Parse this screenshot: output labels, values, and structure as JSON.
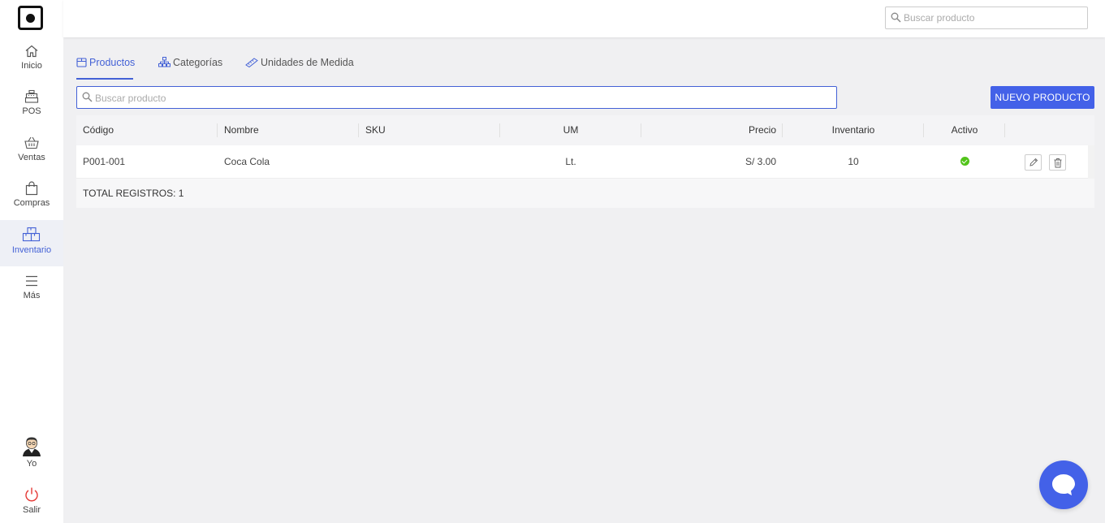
{
  "sidebar": {
    "items": [
      {
        "label": "Inicio",
        "icon": "home-icon"
      },
      {
        "label": "POS",
        "icon": "cash-register-icon"
      },
      {
        "label": "Ventas",
        "icon": "basket-icon"
      },
      {
        "label": "Compras",
        "icon": "shopping-bag-icon"
      },
      {
        "label": "Inventario",
        "icon": "boxes-icon",
        "active": true
      },
      {
        "label": "Más",
        "icon": "menu-icon"
      }
    ],
    "user_label": "Yo",
    "logout_label": "Salir"
  },
  "header": {
    "search_placeholder": "Buscar producto"
  },
  "tabs": [
    {
      "label": "Productos",
      "icon": "box-icon",
      "active": true
    },
    {
      "label": "Categorías",
      "icon": "hierarchy-icon"
    },
    {
      "label": "Unidades de Medida",
      "icon": "ruler-icon"
    }
  ],
  "search": {
    "placeholder": "Buscar producto",
    "value": ""
  },
  "new_button_label": "NUEVO PRODUCTO",
  "table": {
    "columns": [
      "Código",
      "Nombre",
      "SKU",
      "UM",
      "Precio",
      "Inventario",
      "Activo"
    ],
    "rows": [
      {
        "codigo": "P001-001",
        "nombre": "Coca Cola",
        "sku": "",
        "um": "Lt.",
        "precio": "S/ 3.00",
        "inventario": "10",
        "activo": true
      }
    ],
    "total_label": "TOTAL REGISTROS: 1"
  },
  "colors": {
    "accent": "#4361e8",
    "active_status": "#52c41a",
    "logout": "#e53935"
  }
}
